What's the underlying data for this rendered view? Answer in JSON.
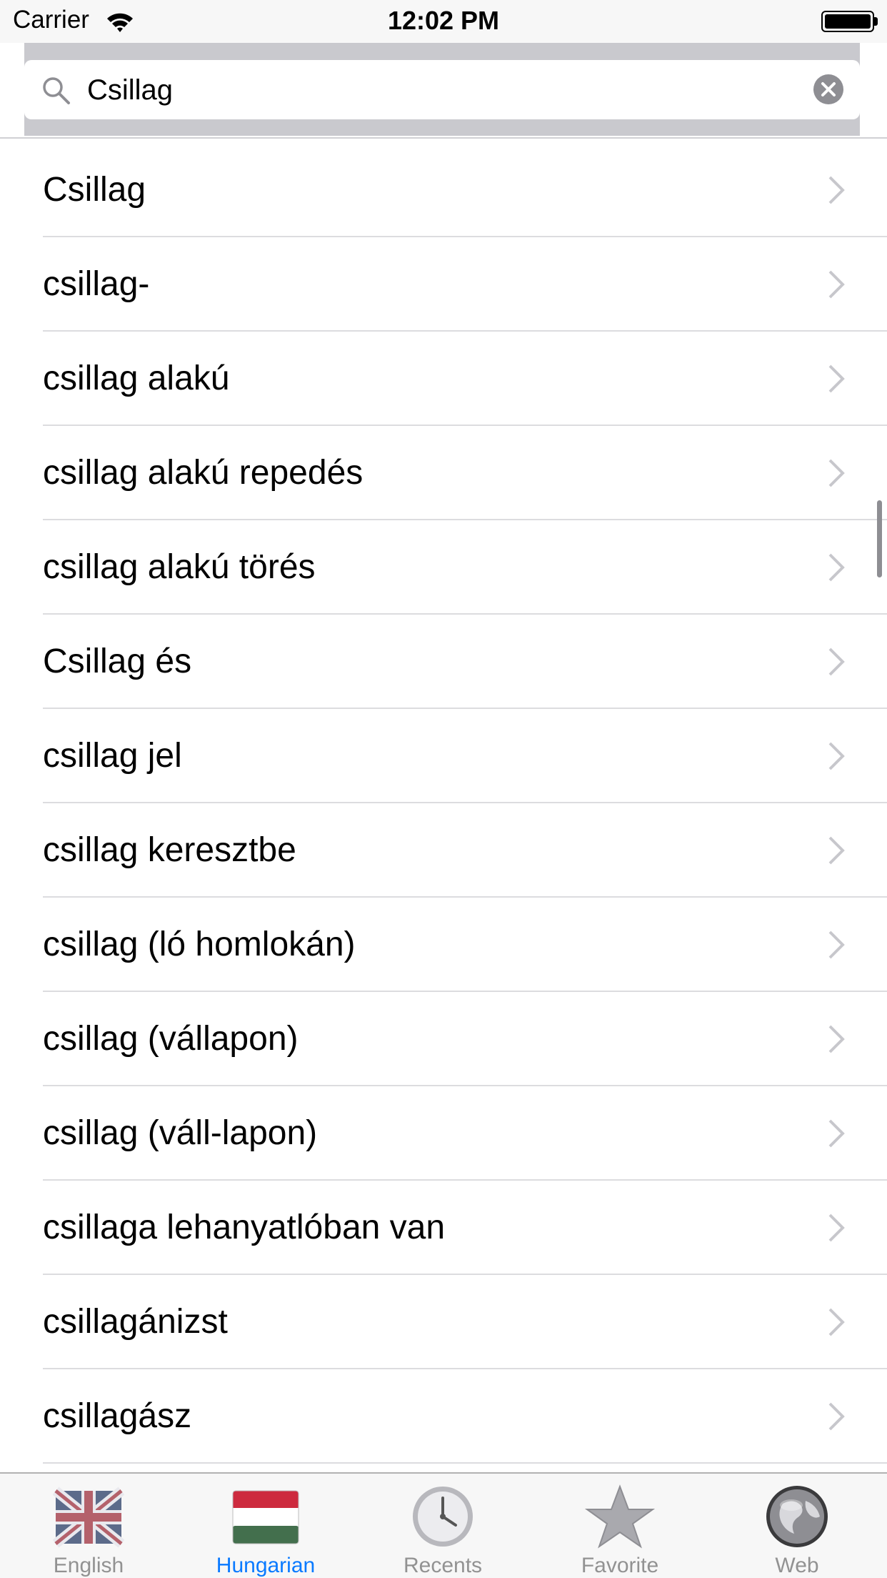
{
  "status_bar": {
    "carrier": "Carrier",
    "time": "12:02 PM"
  },
  "search": {
    "value": "Csillag",
    "icon": "search-icon",
    "clear_icon": "clear-icon"
  },
  "results": [
    {
      "label": "Csillag"
    },
    {
      "label": "csillag-"
    },
    {
      "label": "csillag alakú"
    },
    {
      "label": "csillag alakú repedés"
    },
    {
      "label": "csillag alakú törés"
    },
    {
      "label": "Csillag és"
    },
    {
      "label": "csillag jel"
    },
    {
      "label": "csillag keresztbe"
    },
    {
      "label": "csillag (ló homlokán)"
    },
    {
      "label": "csillag (vállapon)"
    },
    {
      "label": "csillag (váll-lapon)"
    },
    {
      "label": "csillaga lehanyatlóban van"
    },
    {
      "label": "csillagánizst"
    },
    {
      "label": "csillagász"
    }
  ],
  "tabs": [
    {
      "label": "English",
      "icon": "uk-flag-icon",
      "active": false
    },
    {
      "label": "Hungarian",
      "icon": "hungary-flag-icon",
      "active": true
    },
    {
      "label": "Recents",
      "icon": "clock-icon",
      "active": false
    },
    {
      "label": "Favorite",
      "icon": "star-icon",
      "active": false
    },
    {
      "label": "Web",
      "icon": "globe-icon",
      "active": false
    }
  ],
  "colors": {
    "accent": "#0a7aff",
    "tab_inactive": "#929292",
    "search_background": "#c9c9ce",
    "separator": "#dcdcdf",
    "chevron": "#c7c7cc",
    "hungary_red": "#cd2a3e",
    "hungary_green": "#436f4d",
    "uk_blue": "#012169",
    "uk_red": "#c8102e"
  }
}
